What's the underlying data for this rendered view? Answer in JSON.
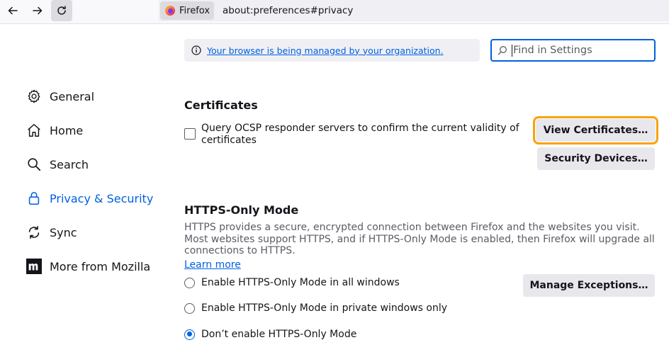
{
  "browser": {
    "identity_label": "Firefox",
    "url": "about:preferences#privacy"
  },
  "banner": {
    "managed_text": "Your browser is being managed by your organization."
  },
  "search": {
    "placeholder": "Find in Settings"
  },
  "sidebar": {
    "items": [
      {
        "label": "General",
        "icon": "gear-icon"
      },
      {
        "label": "Home",
        "icon": "home-icon"
      },
      {
        "label": "Search",
        "icon": "search-icon"
      },
      {
        "label": "Privacy & Security",
        "icon": "lock-icon",
        "active": true
      },
      {
        "label": "Sync",
        "icon": "sync-icon"
      },
      {
        "label": "More from Mozilla",
        "icon": "mozilla-icon"
      }
    ]
  },
  "certificates": {
    "heading": "Certificates",
    "ocsp_label": "Query OCSP responder servers to confirm the current validity of certificates",
    "ocsp_checked": false,
    "view_button": "View Certificates…",
    "devices_button": "Security Devices…"
  },
  "https_only": {
    "heading": "HTTPS-Only Mode",
    "description": "HTTPS provides a secure, encrypted connection between Firefox and the websites you visit. Most websites support HTTPS, and if HTTPS-Only Mode is enabled, then Firefox will upgrade all connections to HTTPS.",
    "learn_more": "Learn more",
    "exceptions_button": "Manage Exceptions…",
    "options": [
      {
        "label": "Enable HTTPS-Only Mode in all windows",
        "checked": false
      },
      {
        "label": "Enable HTTPS-Only Mode in private windows only",
        "checked": false
      },
      {
        "label": "Don’t enable HTTPS-Only Mode",
        "checked": true
      }
    ]
  },
  "colors": {
    "accent": "#0061e0",
    "focus_ring": "#f8a30a"
  }
}
